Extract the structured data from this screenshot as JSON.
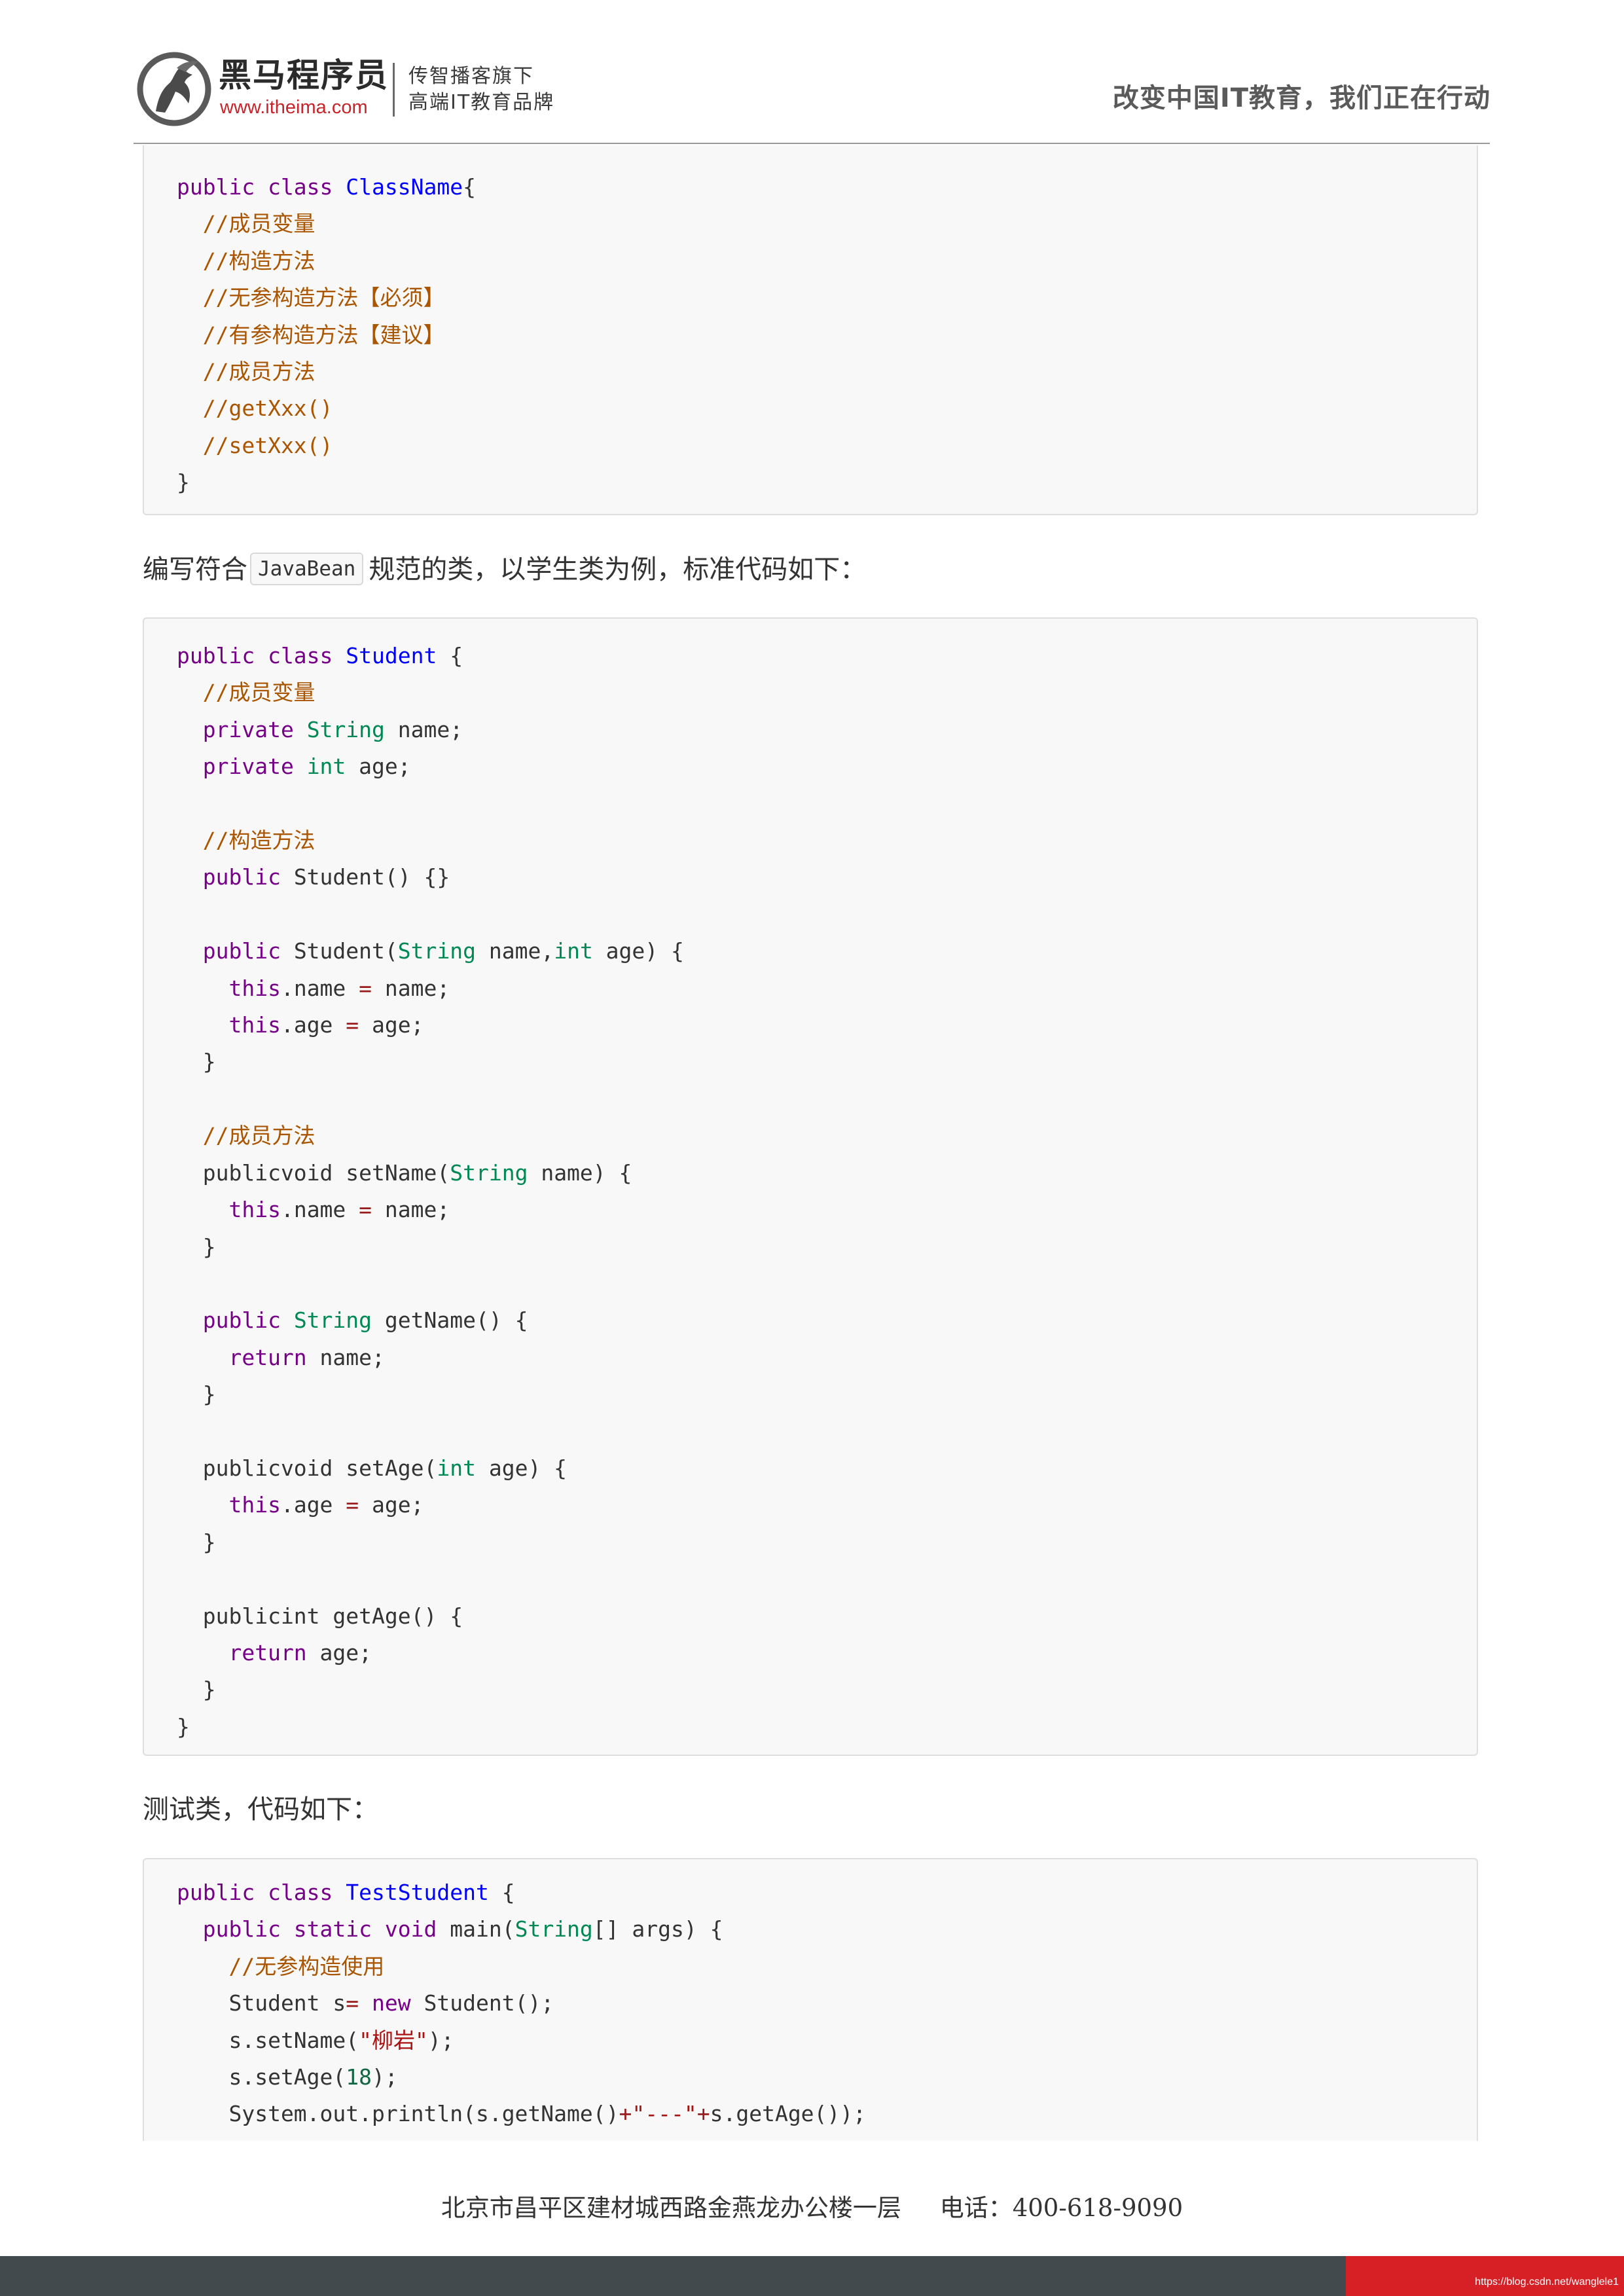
{
  "header": {
    "brand_name": "黑马程序员",
    "brand_url": "www.itheima.com",
    "brand_slogan_line1": "传智播客旗下",
    "brand_slogan_line2": "高端IT教育品牌",
    "slogan": "改变中国IT教育，我们正在行动"
  },
  "code_block_1": {
    "lines": [
      [
        {
          "t": "public class ",
          "c": "kw"
        },
        {
          "t": "ClassName",
          "c": "def"
        },
        {
          "t": "{",
          "c": ""
        }
      ],
      [
        {
          "t": "  //成员变量",
          "c": "cm"
        }
      ],
      [
        {
          "t": "  //构造方法",
          "c": "cm"
        }
      ],
      [
        {
          "t": "  //无参构造方法【必须】",
          "c": "cm"
        }
      ],
      [
        {
          "t": "  //有参构造方法【建议】",
          "c": "cm"
        }
      ],
      [
        {
          "t": "  //成员方法",
          "c": "cm"
        }
      ],
      [
        {
          "t": "  //getXxx()",
          "c": "cm"
        }
      ],
      [
        {
          "t": "  //setXxx()",
          "c": "cm"
        }
      ],
      [
        {
          "t": "}",
          "c": ""
        }
      ]
    ]
  },
  "paragraph_javabean": {
    "before": "编写符合",
    "code": "JavaBean",
    "after": "规范的类，以学生类为例，标准代码如下："
  },
  "code_block_2": {
    "lines": [
      [
        {
          "t": "public class ",
          "c": "kw"
        },
        {
          "t": "Student",
          "c": "def"
        },
        {
          "t": " {",
          "c": ""
        }
      ],
      [
        {
          "t": "  //成员变量",
          "c": "cm"
        }
      ],
      [
        {
          "t": "  private ",
          "c": "kw"
        },
        {
          "t": "String",
          "c": "ty"
        },
        {
          "t": " name;",
          "c": ""
        }
      ],
      [
        {
          "t": "  private ",
          "c": "kw"
        },
        {
          "t": "int",
          "c": "ty"
        },
        {
          "t": " age;",
          "c": ""
        }
      ],
      [],
      [
        {
          "t": "  //构造方法",
          "c": "cm"
        }
      ],
      [
        {
          "t": "  public ",
          "c": "kw"
        },
        {
          "t": "Student() {}",
          "c": ""
        }
      ],
      [],
      [
        {
          "t": "  public ",
          "c": "kw"
        },
        {
          "t": "Student(",
          "c": ""
        },
        {
          "t": "String",
          "c": "ty"
        },
        {
          "t": " name,",
          "c": ""
        },
        {
          "t": "int",
          "c": "ty"
        },
        {
          "t": " age) {",
          "c": ""
        }
      ],
      [
        {
          "t": "    this",
          "c": "kw"
        },
        {
          "t": ".name ",
          "c": ""
        },
        {
          "t": "=",
          "c": "op"
        },
        {
          "t": " name;",
          "c": ""
        }
      ],
      [
        {
          "t": "    this",
          "c": "kw"
        },
        {
          "t": ".age ",
          "c": ""
        },
        {
          "t": "=",
          "c": "op"
        },
        {
          "t": " age;",
          "c": ""
        }
      ],
      [
        {
          "t": "  }",
          "c": ""
        }
      ],
      [],
      [
        {
          "t": "  //成员方法",
          "c": "cm"
        }
      ],
      [
        {
          "t": "  publicvoid ",
          "c": ""
        },
        {
          "t": "setName(",
          "c": ""
        },
        {
          "t": "String",
          "c": "ty"
        },
        {
          "t": " name) {",
          "c": ""
        }
      ],
      [
        {
          "t": "    this",
          "c": "kw"
        },
        {
          "t": ".name ",
          "c": ""
        },
        {
          "t": "=",
          "c": "op"
        },
        {
          "t": " name;",
          "c": ""
        }
      ],
      [
        {
          "t": "  }",
          "c": ""
        }
      ],
      [],
      [
        {
          "t": "  public ",
          "c": "kw"
        },
        {
          "t": "String",
          "c": "ty"
        },
        {
          "t": " getName() {",
          "c": ""
        }
      ],
      [
        {
          "t": "    return",
          "c": "kw"
        },
        {
          "t": " name;",
          "c": ""
        }
      ],
      [
        {
          "t": "  }",
          "c": ""
        }
      ],
      [],
      [
        {
          "t": "  publicvoid ",
          "c": ""
        },
        {
          "t": "setAge(",
          "c": ""
        },
        {
          "t": "int",
          "c": "ty"
        },
        {
          "t": " age) {",
          "c": ""
        }
      ],
      [
        {
          "t": "    this",
          "c": "kw"
        },
        {
          "t": ".age ",
          "c": ""
        },
        {
          "t": "=",
          "c": "op"
        },
        {
          "t": " age;",
          "c": ""
        }
      ],
      [
        {
          "t": "  }",
          "c": ""
        }
      ],
      [],
      [
        {
          "t": "  publicint ",
          "c": ""
        },
        {
          "t": "getAge() {",
          "c": ""
        }
      ],
      [
        {
          "t": "    return",
          "c": "kw"
        },
        {
          "t": " age;",
          "c": ""
        }
      ],
      [
        {
          "t": "  }",
          "c": ""
        }
      ],
      [
        {
          "t": "}",
          "c": ""
        }
      ]
    ]
  },
  "paragraph_test": {
    "text": "测试类，代码如下："
  },
  "code_block_3": {
    "lines": [
      [
        {
          "t": "public class ",
          "c": "kw"
        },
        {
          "t": "TestStudent",
          "c": "def"
        },
        {
          "t": " {",
          "c": ""
        }
      ],
      [
        {
          "t": "  public static void ",
          "c": "kw"
        },
        {
          "t": "main(",
          "c": ""
        },
        {
          "t": "String",
          "c": "ty"
        },
        {
          "t": "[] args) {",
          "c": ""
        }
      ],
      [
        {
          "t": "    //无参构造使用",
          "c": "cm"
        }
      ],
      [
        {
          "t": "    Student s",
          "c": ""
        },
        {
          "t": "=",
          "c": "op"
        },
        {
          "t": " ",
          "c": ""
        },
        {
          "t": "new",
          "c": "kw"
        },
        {
          "t": " Student();",
          "c": ""
        }
      ],
      [
        {
          "t": "    s.setName(",
          "c": ""
        },
        {
          "t": "\"柳岩\"",
          "c": "str"
        },
        {
          "t": ");",
          "c": ""
        }
      ],
      [
        {
          "t": "    s.setAge(",
          "c": ""
        },
        {
          "t": "18",
          "c": "num"
        },
        {
          "t": ");",
          "c": ""
        }
      ],
      [
        {
          "t": "    System.out.println(s.getName()",
          "c": ""
        },
        {
          "t": "+",
          "c": "op"
        },
        {
          "t": "\"---\"",
          "c": "str"
        },
        {
          "t": "+",
          "c": "op"
        },
        {
          "t": "s.getAge());",
          "c": ""
        }
      ]
    ]
  },
  "footer": {
    "address": "北京市昌平区建材城西路金燕龙办公楼一层     电话：400-618-9090",
    "watermark": "https://blog.csdn.net/wanglele1"
  }
}
